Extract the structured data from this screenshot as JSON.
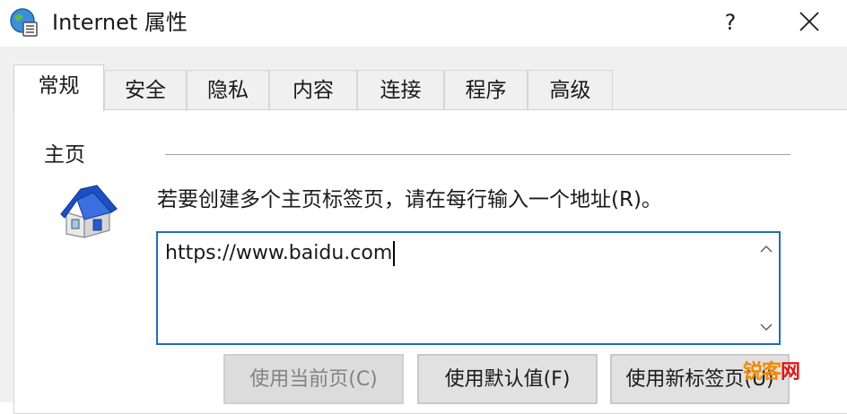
{
  "window": {
    "title": "Internet 属性",
    "help_label": "?"
  },
  "tabs": [
    {
      "label": "常规",
      "active": true
    },
    {
      "label": "安全",
      "active": false
    },
    {
      "label": "隐私",
      "active": false
    },
    {
      "label": "内容",
      "active": false
    },
    {
      "label": "连接",
      "active": false
    },
    {
      "label": "程序",
      "active": false
    },
    {
      "label": "高级",
      "active": false
    }
  ],
  "homepage": {
    "group_title": "主页",
    "description": "若要创建多个主页标签页，请在每行输入一个地址(R)。",
    "urls_value": "https://www.baidu.com",
    "buttons": {
      "use_current": {
        "label": "使用当前页(C)",
        "enabled": false
      },
      "use_default": {
        "label": "使用默认值(F)",
        "enabled": true
      },
      "use_new_tab": {
        "label": "使用新标签页(U)",
        "enabled": true
      }
    }
  },
  "watermark": {
    "part1": "锐客",
    "part2": "网"
  },
  "colors": {
    "focus_border": "#1f6fb3",
    "house_roof": "#1d4fc4",
    "watermark_orange": "#f08a00",
    "watermark_red": "#e01818"
  }
}
